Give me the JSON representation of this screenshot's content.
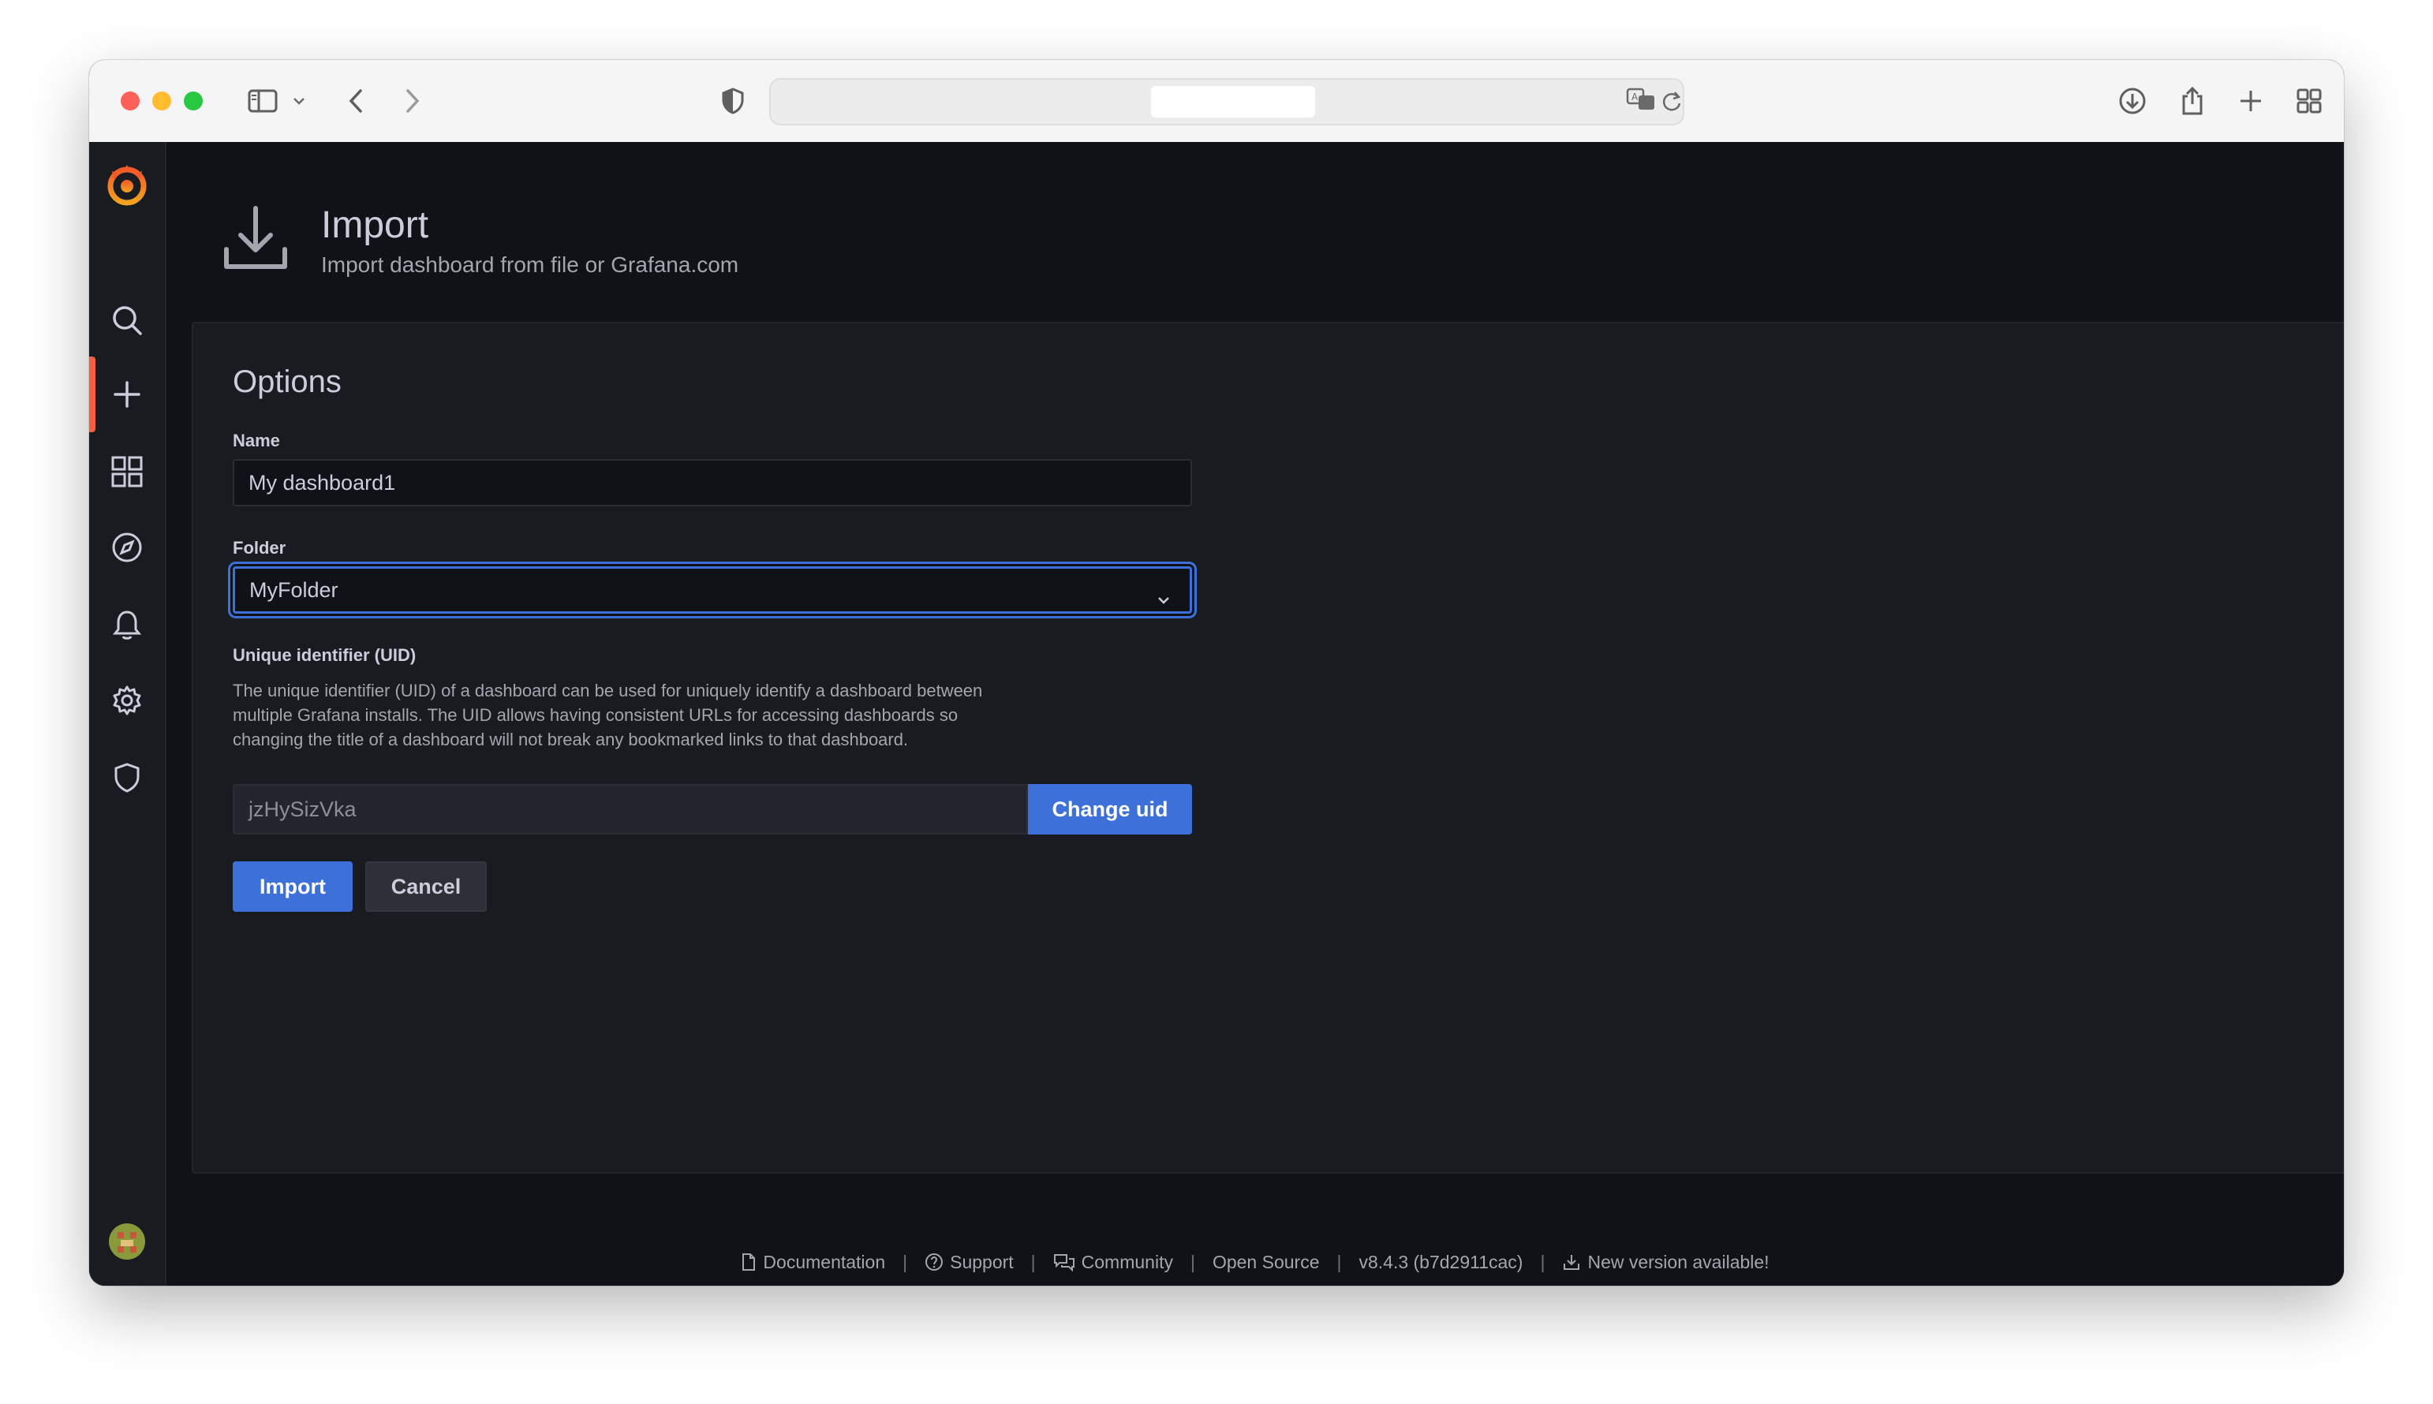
{
  "browser": {
    "url": ""
  },
  "page": {
    "title": "Import",
    "subtitle": "Import dashboard from file or Grafana.com"
  },
  "options": {
    "heading": "Options",
    "name_label": "Name",
    "name_value": "My dashboard1",
    "folder_label": "Folder",
    "folder_value": "MyFolder",
    "uid_label": "Unique identifier (UID)",
    "uid_description": "The unique identifier (UID) of a dashboard can be used for uniquely identify a dashboard between multiple Grafana installs. The UID allows having consistent URLs for accessing dashboards so changing the title of a dashboard will not break any bookmarked links to that dashboard.",
    "uid_value": "jzHySizVka",
    "change_uid_label": "Change uid",
    "import_label": "Import",
    "cancel_label": "Cancel"
  },
  "footer": {
    "documentation": "Documentation",
    "support": "Support",
    "community": "Community",
    "open_source": "Open Source",
    "version": "v8.4.3 (b7d2911cac)",
    "new_version": "New version available!",
    "separator": "|"
  },
  "sidebar": {
    "items": [
      "grafana-logo-icon",
      "search-icon",
      "plus-icon",
      "dashboards-icon",
      "explore-icon",
      "alerting-icon",
      "config-icon",
      "shield-icon",
      "avatar",
      "help-icon"
    ],
    "accent_color": "#f55f3e"
  },
  "colors": {
    "primary": "#3d71d9",
    "background": "#111217",
    "panel": "#181b1f"
  }
}
